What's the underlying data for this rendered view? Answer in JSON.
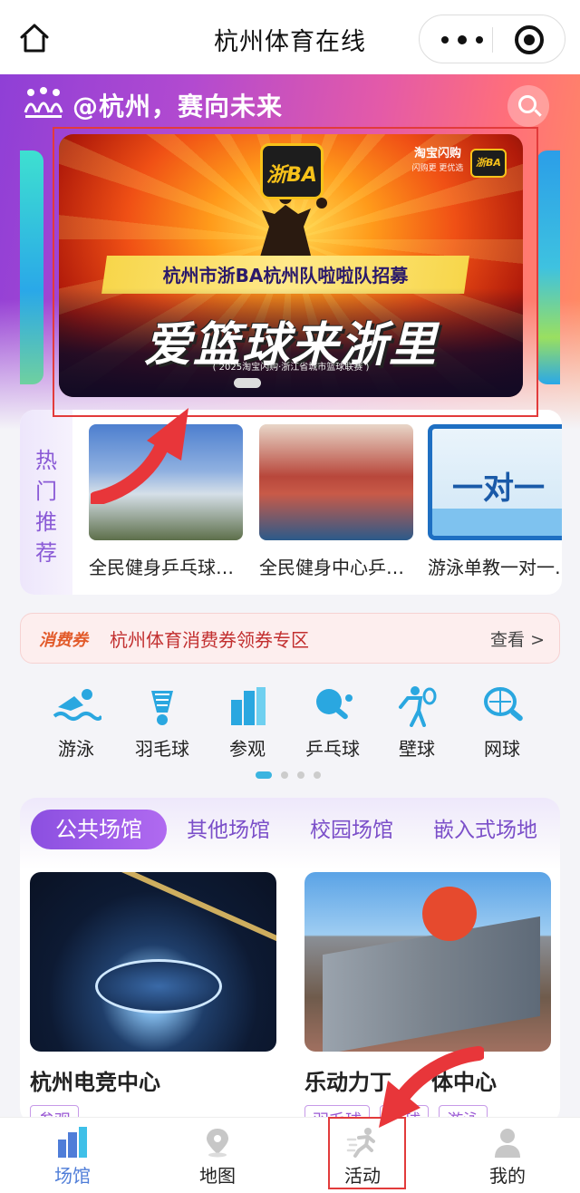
{
  "nav": {
    "title": "杭州体育在线"
  },
  "hero": {
    "slogan": "@杭州，赛向未来",
    "banner": {
      "logo_text": "浙BA",
      "sponsor": "淘宝闪购",
      "sponsor_sub": "闪购更 更优选",
      "recruit_title": "杭州市浙BA杭州队啦啦队招募",
      "big_slogan": "爱篮球来浙里",
      "league_line": "( 2025淘宝闪购·浙江省城市篮球联赛 )"
    }
  },
  "hot": {
    "label_chars": [
      "热",
      "门",
      "推",
      "荐"
    ],
    "items": [
      {
        "title": "全民健身乒乓球…"
      },
      {
        "title": "全民健身中心乒…"
      },
      {
        "title": "游泳单教一对一…",
        "thumb_text": "一对一"
      }
    ]
  },
  "voucher": {
    "tag": "消费券",
    "text": "杭州体育消费券领券专区",
    "view": "查看 >"
  },
  "categories": [
    {
      "label": "游泳",
      "icon": "swimming-icon"
    },
    {
      "label": "羽毛球",
      "icon": "badminton-icon"
    },
    {
      "label": "参观",
      "icon": "building-icon"
    },
    {
      "label": "乒乓球",
      "icon": "table-tennis-icon"
    },
    {
      "label": "壁球",
      "icon": "squash-icon"
    },
    {
      "label": "网球",
      "icon": "tennis-icon"
    }
  ],
  "venue_tabs": [
    "公共场馆",
    "其他场馆",
    "校园场馆",
    "嵌入式场地"
  ],
  "venues": [
    {
      "name": "杭州电竞中心",
      "chips": [
        "参观"
      ]
    },
    {
      "name": "乐动力丁",
      "name_suffix": "体中心",
      "chips": [
        "羽毛球",
        "…球",
        "游泳"
      ]
    }
  ],
  "tabbar": [
    {
      "label": "场馆",
      "icon": "venue-icon",
      "active": true
    },
    {
      "label": "地图",
      "icon": "map-pin-icon",
      "active": false
    },
    {
      "label": "活动",
      "icon": "running-icon",
      "active": false
    },
    {
      "label": "我的",
      "icon": "profile-icon",
      "active": false
    }
  ],
  "colors": {
    "accent_purple": "#8b4fe0",
    "tab_active_blue": "#4f7dd8",
    "voucher_red": "#c22f2f",
    "annotation_red": "#e23b3b"
  }
}
